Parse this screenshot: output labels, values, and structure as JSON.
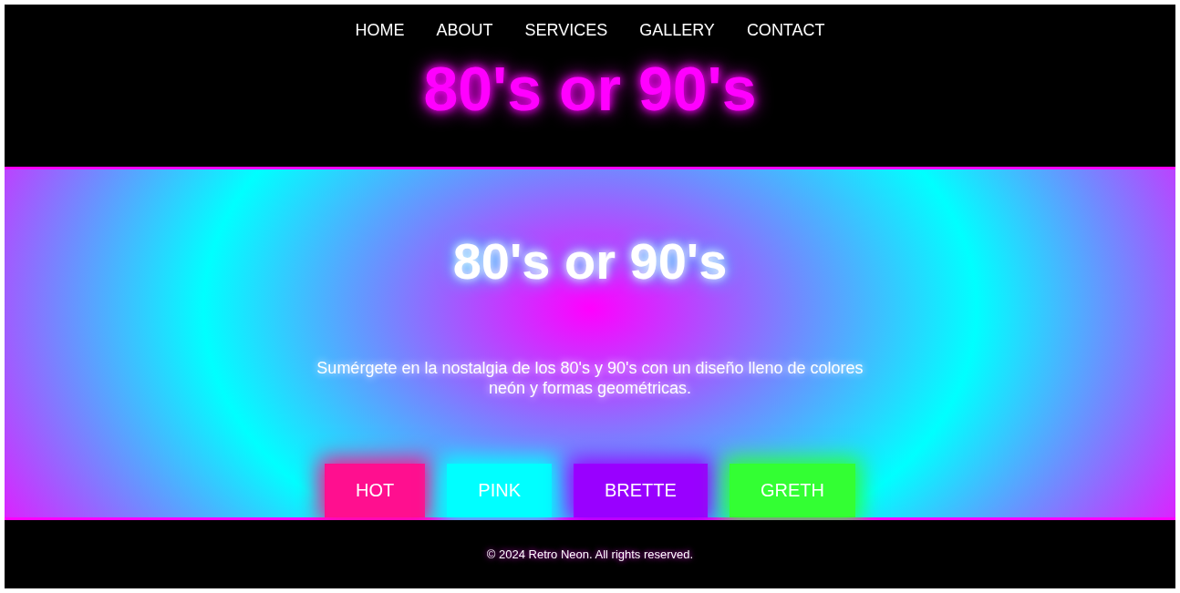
{
  "nav": [
    "HOME",
    "ABOUT",
    "SERVICES",
    "GALLERY",
    "CONTACT"
  ],
  "logo": "80's or 90's",
  "hero": {
    "title": "80's or 90's",
    "text": "Sumérgete en la nostalgia de los 80's y 90's con un diseño lleno de colores neón y formas geométricas.",
    "buttons": [
      {
        "label": "HOT",
        "color": "#ff0f8f"
      },
      {
        "label": "PINK",
        "color": "#00ffff"
      },
      {
        "label": "BRETTE",
        "color": "#9900ff"
      },
      {
        "label": "GRETH",
        "color": "#33ff33"
      }
    ]
  },
  "footer": "© 2024 Retro Neon. All rights reserved."
}
